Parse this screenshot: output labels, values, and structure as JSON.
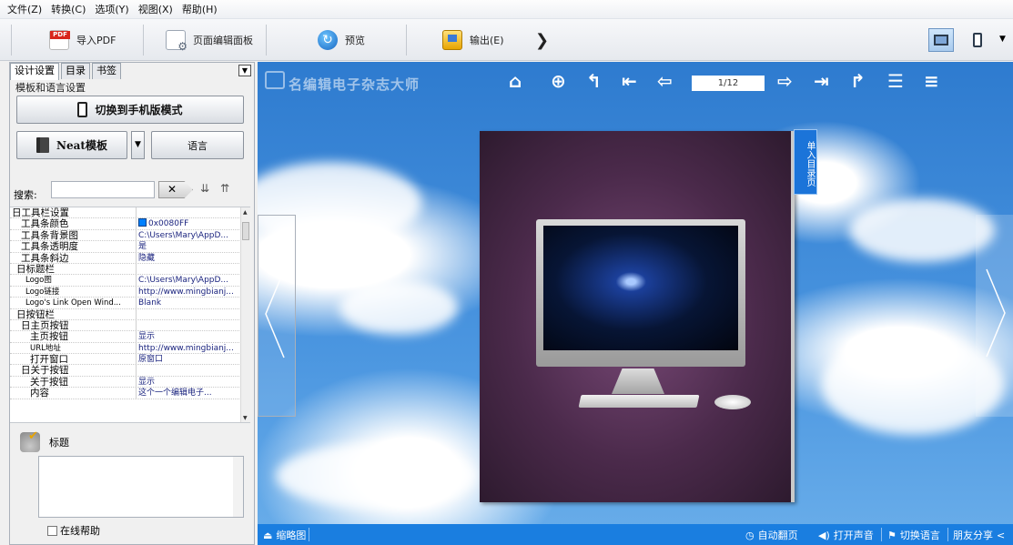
{
  "menu": [
    "文件(Z)",
    "转换(C)",
    "选项(Y)",
    "视图(X)",
    "帮助(H)"
  ],
  "toolbar": {
    "import_pdf": "导入PDF",
    "page_editor": "页面编辑面板",
    "preview": "预览",
    "output": "输出(E)",
    "more_icon": "chevron-right-icon",
    "desktop_view": "desktop-icon",
    "phone_view": "phone-icon"
  },
  "left": {
    "tabs": [
      "设计设置",
      "目录",
      "书签"
    ],
    "group_label": "模板和语言设置",
    "switch_mobile": "切换到手机版模式",
    "template": "Neat模板",
    "language": "语言",
    "search_label": "搜索:",
    "search_value": "",
    "props": [
      {
        "k": "日工具栏设置",
        "v": "",
        "indent": 0
      },
      {
        "k": "工具条颜色",
        "v": "0x0080FF",
        "indent": 2,
        "swatch": true
      },
      {
        "k": "工具条背景图",
        "v": "C:\\Users\\Mary\\AppD...",
        "indent": 2
      },
      {
        "k": "工具条透明度",
        "v": "是",
        "indent": 2
      },
      {
        "k": "工具条斜边",
        "v": "隐藏",
        "indent": 2
      },
      {
        "k": "日标题栏",
        "v": "",
        "indent": 1
      },
      {
        "k": "Logo图",
        "v": "C:\\Users\\Mary\\AppD...",
        "indent": 3,
        "small": true
      },
      {
        "k": "Logo链接",
        "v": "http://www.mingbianj...",
        "indent": 3,
        "small": true
      },
      {
        "k": "Logo's Link Open Wind...",
        "v": "Blank",
        "indent": 3,
        "small": true
      },
      {
        "k": "日按钮栏",
        "v": "",
        "indent": 1
      },
      {
        "k": "日主页按钮",
        "v": "",
        "indent": 2
      },
      {
        "k": "主页按钮",
        "v": "显示",
        "indent": 4
      },
      {
        "k": "URL地址",
        "v": "http://www.mingbianj...",
        "indent": 4,
        "small": true
      },
      {
        "k": "打开窗口",
        "v": "原窗口",
        "indent": 4
      },
      {
        "k": "日关于按钮",
        "v": "",
        "indent": 2
      },
      {
        "k": "关于按钮",
        "v": "显示",
        "indent": 4
      },
      {
        "k": "内容",
        "v": "这个一个编辑电子...",
        "indent": 4
      }
    ],
    "title_label": "标题",
    "title_value": "",
    "online_help": "在线帮助"
  },
  "preview": {
    "brand": "名编辑电子杂志大师",
    "page": "1/12",
    "toc_tab": "单入目录页",
    "bottom": {
      "thumbnails": "缩略图",
      "autoflip": "自动翻页",
      "sound": "打开声音",
      "lang": "切换语言",
      "share": "朋友分享"
    }
  },
  "colors": {
    "toolbar_blue": "#0080FF",
    "bottom_bar": "#1A7EE0"
  }
}
